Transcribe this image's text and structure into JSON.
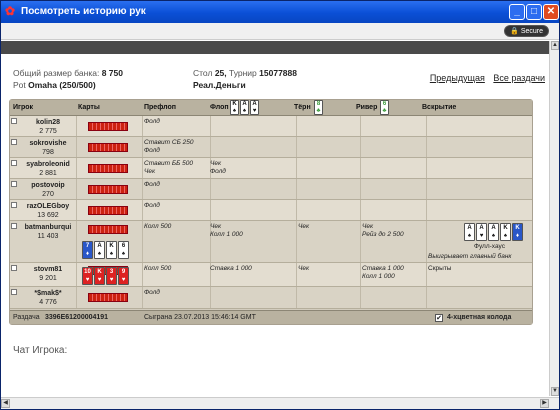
{
  "window": {
    "title": "Посмотреть историю рук",
    "secure_label": "Secure",
    "minimize_glyph": "_",
    "maximize_glyph": "□",
    "close_glyph": "✕"
  },
  "info": {
    "bank_label": "Общий размер банка:",
    "bank_value": "8 750",
    "pot_label": "Pot",
    "pot_value": "Omaha (250/500)",
    "table_label": "Стол",
    "table_value": "25,",
    "tournament_label": "Турнир",
    "tournament_value": "15077888",
    "mode": "Реал.Деньги"
  },
  "links": {
    "prev": "Предыдущая",
    "all": "Все раздачи"
  },
  "headers": {
    "player": "Игрок",
    "cards": "Карты",
    "preflop": "Префлоп",
    "flop": "Флоп",
    "turn": "Тёрн",
    "river": "Ривер",
    "showdown": "Вскрытие"
  },
  "board": {
    "flop": [
      {
        "r": "K",
        "s": "♠",
        "c": "s"
      },
      {
        "r": "A",
        "s": "♠",
        "c": "s"
      },
      {
        "r": "A",
        "s": "♥",
        "c": "s"
      }
    ],
    "turn": [
      {
        "r": "8",
        "s": "♣",
        "c": "c"
      }
    ],
    "river": [
      {
        "r": "6",
        "s": "♣",
        "c": "c"
      }
    ]
  },
  "players": [
    {
      "name": "kolin28",
      "stack": "2 775",
      "preflop": "Фолд",
      "flop": "",
      "turn": "",
      "river": ""
    },
    {
      "name": "sokrovishe",
      "stack": "798",
      "preflop": "Ставит СБ 250\nФолд",
      "flop": "",
      "turn": "",
      "river": ""
    },
    {
      "name": "syabroleonid",
      "stack": "2 881",
      "preflop": "Ставит ББ 500\nЧек",
      "flop": "Чек\nФолд",
      "turn": "",
      "river": ""
    },
    {
      "name": "postovoip",
      "stack": "270",
      "preflop": "Фолд",
      "flop": "",
      "turn": "",
      "river": ""
    },
    {
      "name": "razOLEGboy",
      "stack": "13 692",
      "preflop": "Фолд",
      "flop": "",
      "turn": "",
      "river": ""
    },
    {
      "name": "batmanburqui",
      "stack": "11 403",
      "preflop": "Колл 500",
      "flop": "Чек\nКолл 1 000",
      "turn": "Чек",
      "river": "Чек\nРейз до 2 500",
      "hole": [
        {
          "r": "7",
          "s": "♦",
          "c": "d"
        },
        {
          "r": "A",
          "s": "♠",
          "c": "s"
        },
        {
          "r": "K",
          "s": "♠",
          "c": "s"
        },
        {
          "r": "6",
          "s": "♠",
          "c": "s"
        }
      ],
      "showdown": {
        "hand_name": "Фулл-хаус",
        "result": "Выигрывает главный банк",
        "cards": [
          {
            "r": "A",
            "s": "♠",
            "c": "s"
          },
          {
            "r": "A",
            "s": "♥",
            "c": "s"
          },
          {
            "r": "A",
            "s": "♠",
            "c": "s"
          },
          {
            "r": "K",
            "s": "♠",
            "c": "s"
          },
          {
            "r": "K",
            "s": "♦",
            "c": "d"
          }
        ]
      }
    },
    {
      "name": "stovm81",
      "stack": "9 201",
      "preflop": "Колл 500",
      "flop": "Ставка 1 000",
      "turn": "Чек",
      "river": "Ставка 1 000\nКолл 1 000",
      "hole": [
        {
          "r": "10",
          "s": "♥",
          "c": "h"
        },
        {
          "r": "K",
          "s": "♥",
          "c": "h"
        },
        {
          "r": "3",
          "s": "♥",
          "c": "h"
        },
        {
          "r": "9",
          "s": "♥",
          "c": "h"
        }
      ],
      "showdown_text": "Скрыты"
    },
    {
      "name": "*$mak$*",
      "stack": "4 776",
      "preflop": "Фолд",
      "flop": "",
      "turn": "",
      "river": ""
    }
  ],
  "footer": {
    "hand_label": "Раздача",
    "hand_id": "3396E61200004191",
    "played_label": "Сыграна 23.07.2013 15:46:14 GMT",
    "four_color": "4-хцветная колода",
    "four_color_checked": "✔"
  },
  "chat": {
    "label": "Чат Игрока:"
  }
}
